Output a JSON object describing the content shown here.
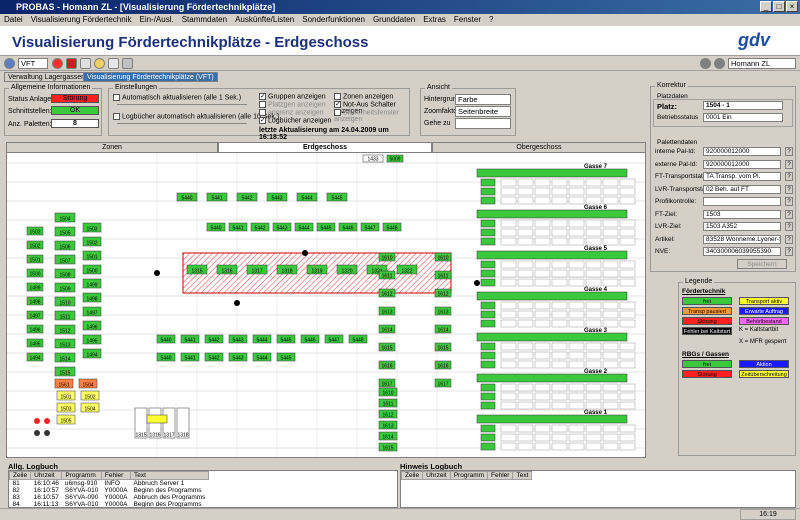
{
  "window": {
    "title": "PROBAS - Homann ZL - [Visualisierung Fördertechnikplätze]"
  },
  "menu": [
    "Datei",
    "Visualisierung Fördertechnik",
    "Ein-/Ausl.",
    "Stammdaten",
    "Auskünfte/Listen",
    "Sonderfunktionen",
    "Grunddaten",
    "Extras",
    "Fenster",
    "?"
  ],
  "header": {
    "title": "Visualisierung Fördertechnikplätze - Erdgeschoss",
    "logo": "gdv"
  },
  "toolbar": {
    "vft_value": "VFT",
    "user_value": "Homann ZL"
  },
  "subtabs": [
    "Verwaltung Lagergassen (BSG)",
    "Visualisierung Fördertechnikplätze (VFT)"
  ],
  "general": {
    "title": "Allgemeine Informationen",
    "status_label": "Status Anlage:",
    "status_value": "Störung",
    "interfaces_label": "Schnittstellen:",
    "interfaces_value": "OK",
    "pallets_label": "Anz. Paletten:",
    "pallets_value": "8"
  },
  "settings": {
    "title": "Einstellungen",
    "auto1": "Automatisch aktualisieren (alle 1 Sek.)",
    "auto10": "Logbücher automatisch aktualisieren (alle 10 Sek.)",
    "groups": "Gruppen anzeigen",
    "platznr": "Platzgen anzeigen",
    "angrenz": "angrenz anzeigen",
    "logbook": "Logbücher anzeigen",
    "zones": "Zonen anzeigen",
    "notaus": "Not-Aus Schalter anzeigen",
    "safety": "Sicherheitsfenster anzeigen",
    "last_update": "letzte Aktualisierung am 24.04.2009 um 16:18:52"
  },
  "view": {
    "title": "Ansicht",
    "bg_label": "Hintergrund",
    "bg_value": "Farbe",
    "zoom_label": "Zoomfaktor",
    "zoom_value": "Seitenbreite",
    "goto_label": "Gehe zu"
  },
  "tabs": [
    "Zonen",
    "Erdgeschoss",
    "Obergeschoss"
  ],
  "plan": {
    "gassen": [
      "Gasse 7",
      "Gasse 6",
      "Gasse 5",
      "Gasse 4",
      "Gasse 3",
      "Gasse 2",
      "Gasse 1"
    ],
    "top_labels": [
      "1433",
      "5009"
    ],
    "left_ids": [
      "1504",
      "1505",
      "1506",
      "1507",
      "1508",
      "1509",
      "1510",
      "1511",
      "1512",
      "1513",
      "1514",
      "1515"
    ],
    "col2_ids": [
      "1503",
      "1502",
      "1501",
      "1500",
      "1499",
      "1498",
      "1497",
      "1496",
      "1495",
      "1494"
    ],
    "mid_ids": [
      "1315",
      "1316",
      "1317",
      "1318",
      "1319",
      "1320",
      "1321",
      "1322"
    ],
    "row_ids": [
      "5440",
      "5441",
      "5442",
      "5443",
      "5444",
      "5445",
      "5446",
      "5447",
      "5448"
    ],
    "bottom_ids": [
      "1501",
      "1502",
      "1503",
      "1504",
      "1505"
    ],
    "mid_col_ids": [
      "1610",
      "1611",
      "1612",
      "1613",
      "1614",
      "1615",
      "1616",
      "1617"
    ],
    "orange_ids": [
      "1561",
      "1504"
    ]
  },
  "korrektur": {
    "title": "Korrektur",
    "platz_title": "Platzdaten",
    "platz_label": "Platz:",
    "platz_value": "1504 - 1",
    "status_label": "Betriebsstatus",
    "status_value": "0001 Ein",
    "pallet_title": "Palettendaten",
    "fields": [
      {
        "label": "interne Pal-Id:",
        "value": "920000012000"
      },
      {
        "label": "externe Pal-Id:",
        "value": "920000012000"
      },
      {
        "label": "FT-Transportstat.",
        "value": "TA Transp. vom Pl."
      },
      {
        "label": "LVR-Transportstat.",
        "value": "02 Beh. auf FT"
      },
      {
        "label": "Profilkontrolle:",
        "value": ""
      },
      {
        "label": "FT-Ziel:",
        "value": "1503"
      },
      {
        "label": "LVR-Ziel:",
        "value": "1503 A352"
      },
      {
        "label": "Artikel:",
        "value": "83528 Wonneme.Lyoner-Sal"
      },
      {
        "label": "NVE:",
        "value": "340300006039955390"
      }
    ],
    "save_label": "Speichern"
  },
  "legend": {
    "title": "Legende",
    "ft_title": "Fördertechnik",
    "rbg_title": "RBGs / Gassen",
    "ft_items": [
      {
        "label": "frei",
        "bg": "#3cc83c",
        "fg": "#000"
      },
      {
        "label": "Transport aktiv",
        "bg": "#ffff33",
        "fg": "#000"
      },
      {
        "label": "Transp pausiert",
        "bg": "#ff9933",
        "fg": "#000"
      },
      {
        "label": "Erwarte Auftrag",
        "bg": "#1a1aff",
        "fg": "#fff"
      },
      {
        "label": "Störung",
        "bg": "#ff2020",
        "fg": "#000"
      },
      {
        "label": "Behörlbestand",
        "bg": "#ff66ff",
        "fg": "#000"
      },
      {
        "label": "Fehler bei Kaltstart",
        "bg": "#000",
        "fg": "#fff"
      }
    ],
    "kaltstart": "K = Kaltstartbit",
    "mfr": "X = MFR gesperrt",
    "rbg_items": [
      {
        "label": "frei",
        "bg": "#3cc83c",
        "fg": "#000"
      },
      {
        "label": "Aktion",
        "bg": "#1a1aff",
        "fg": "#fff"
      },
      {
        "label": "Störung",
        "bg": "#ff2020",
        "fg": "#000"
      },
      {
        "label": "Zeitüberschreitung",
        "bg": "#ffff33",
        "fg": "#000"
      }
    ]
  },
  "logbook": {
    "title": "Allg. Logbuch",
    "headers": [
      "Zeile",
      "Uhrzeit",
      "Programm",
      "Fehler",
      "Text"
    ],
    "rows": [
      [
        "81",
        "16:10:46",
        "u6msg-910",
        "INFO",
        "Abbruch Server 1"
      ],
      [
        "82",
        "16:10:57",
        "S6YVA-010",
        "Y0000A",
        "Beginn des Programms"
      ],
      [
        "83",
        "16:10:57",
        "S6YVA-090",
        "Y0000A",
        "Abbruch des Programms"
      ],
      [
        "84",
        "16:11:13",
        "S6YVA-010",
        "Y0000A",
        "Beginn des Programms"
      ]
    ]
  },
  "hinweis": {
    "title": "Hinweis Logbuch",
    "headers": [
      "Zeile",
      "Uhrzeit",
      "Programm",
      "Fehler",
      "Text"
    ]
  },
  "status": {
    "time": "16:19"
  }
}
